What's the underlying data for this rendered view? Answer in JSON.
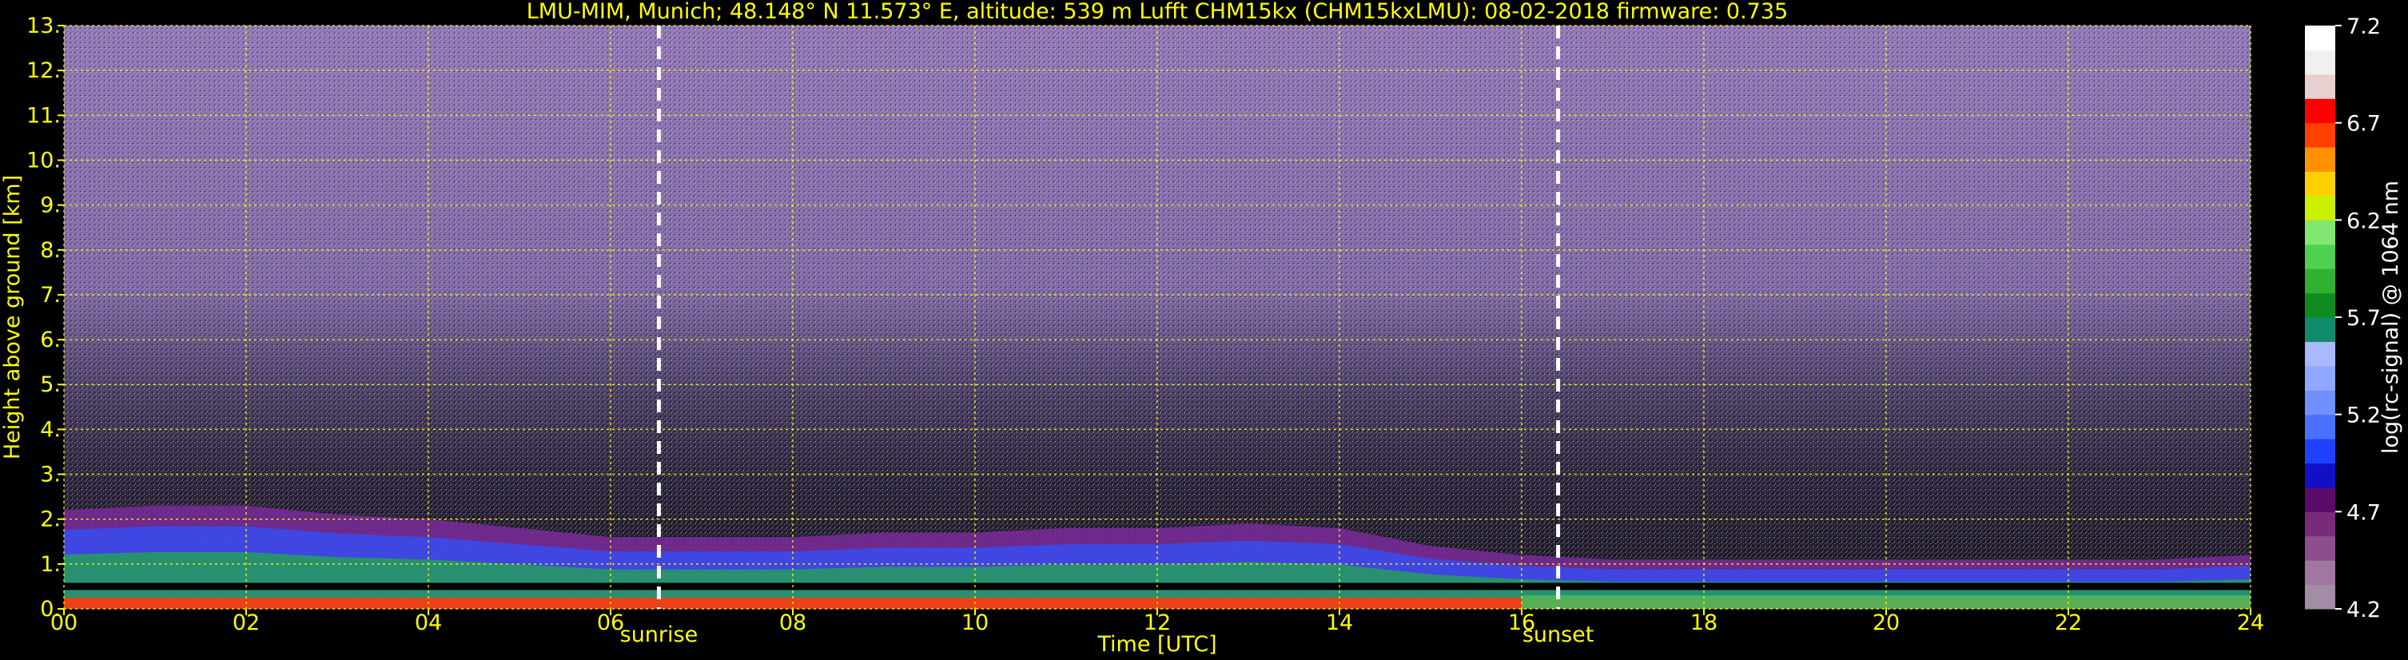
{
  "chart_data": {
    "type": "heatmap",
    "title": "LMU-MIM, Munich; 48.148° N 11.573° E, altitude: 539 m    Lufft CHM15kx (CHM15kxLMU): 08-02-2018    firmware: 0.735",
    "xlabel": "Time [UTC]",
    "ylabel": "Height above ground [km]",
    "colorbar_label": "log(rc-signal) @ 1064 nm",
    "xlim": [
      0,
      24
    ],
    "ylim": [
      0,
      13
    ],
    "x_ticks": [
      "00",
      "02",
      "04",
      "06",
      "08",
      "10",
      "12",
      "14",
      "16",
      "18",
      "20",
      "22",
      "24"
    ],
    "x_tick_values": [
      0,
      2,
      4,
      6,
      8,
      10,
      12,
      14,
      16,
      18,
      20,
      22,
      24
    ],
    "y_ticks": [
      "0.",
      "1.",
      "2.",
      "3.",
      "4.",
      "5.",
      "6.",
      "7.",
      "8.",
      "9.",
      "10.",
      "11.",
      "12.",
      "13."
    ],
    "y_tick_values": [
      0,
      1,
      2,
      3,
      4,
      5,
      6,
      7,
      8,
      9,
      10,
      11,
      12,
      13
    ],
    "colorbar_ticks": [
      "4.2",
      "4.7",
      "5.2",
      "5.7",
      "6.2",
      "6.7",
      "7.2"
    ],
    "colorbar_tick_values": [
      4.2,
      4.7,
      5.2,
      5.7,
      6.2,
      6.7,
      7.2
    ],
    "clim": [
      4.2,
      7.2
    ],
    "colormap": [
      "#a38ca6",
      "#a0779f",
      "#8d4e8d",
      "#7a2a7a",
      "#5a0a6a",
      "#1010c8",
      "#2040ff",
      "#4a70ff",
      "#7090ff",
      "#90a8ff",
      "#a9b8ff",
      "#108a6a",
      "#108a20",
      "#30b030",
      "#50d050",
      "#80e870",
      "#c8f000",
      "#ffd000",
      "#ff9000",
      "#ff4000",
      "#ff0000",
      "#e8d0d0",
      "#f0f0f0",
      "#ffffff"
    ],
    "annotations": [
      {
        "label": "sunrise",
        "x": 6.53
      },
      {
        "label": "sunset",
        "x": 16.4
      }
    ],
    "grid": true,
    "grid_color": "#ffff00",
    "text_color": "#ffff00",
    "cloud_base_km": 0.5,
    "boundary_layer_top_km": [
      [
        0,
        2.2
      ],
      [
        1,
        2.3
      ],
      [
        2,
        2.3
      ],
      [
        3,
        2.1
      ],
      [
        4,
        2.0
      ],
      [
        5,
        1.8
      ],
      [
        6,
        1.6
      ],
      [
        7,
        1.6
      ],
      [
        8,
        1.6
      ],
      [
        9,
        1.7
      ],
      [
        10,
        1.7
      ],
      [
        11,
        1.8
      ],
      [
        12,
        1.8
      ],
      [
        13,
        1.9
      ],
      [
        14,
        1.8
      ],
      [
        15,
        1.4
      ],
      [
        16,
        1.2
      ],
      [
        17,
        1.1
      ],
      [
        18,
        1.1
      ],
      [
        19,
        1.1
      ],
      [
        20,
        1.1
      ],
      [
        21,
        1.1
      ],
      [
        22,
        1.1
      ],
      [
        23,
        1.1
      ],
      [
        24,
        1.2
      ]
    ]
  }
}
